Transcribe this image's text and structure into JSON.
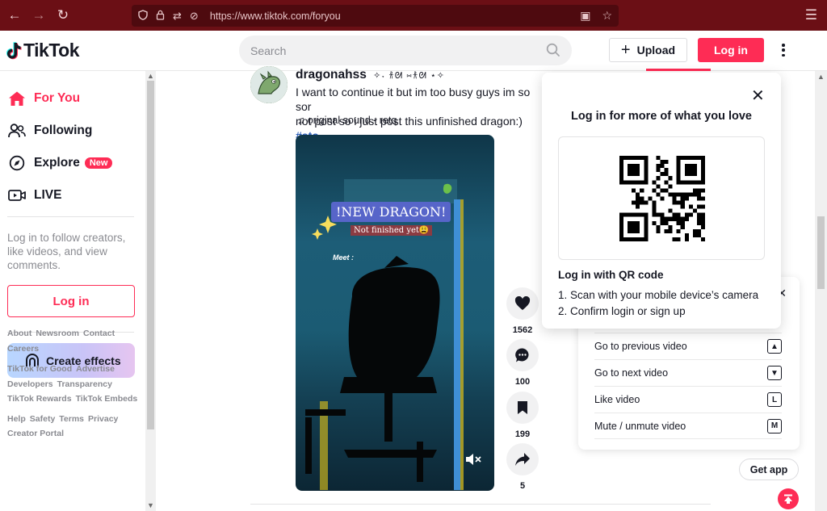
{
  "browser": {
    "url": "https://www.tiktok.com/foryou"
  },
  "header": {
    "logo_text": "TikTok",
    "search_placeholder": "Search",
    "upload_label": "Upload",
    "login_label": "Log in"
  },
  "sidebar": {
    "nav": [
      {
        "label": "For You",
        "icon": "home-icon",
        "active": true
      },
      {
        "label": "Following",
        "icon": "people-icon"
      },
      {
        "label": "Explore",
        "icon": "compass-icon",
        "badge": "New"
      },
      {
        "label": "LIVE",
        "icon": "live-icon"
      }
    ],
    "prompt_text": "Log in to follow creators, like videos, and view comments.",
    "login_label": "Log in",
    "effects_label": "Create effects",
    "footer_rows": [
      [
        "About",
        "Newsroom",
        "Contact"
      ],
      [
        "Careers"
      ],
      [
        "TikTok for Good",
        "Advertise"
      ],
      [
        "Developers",
        "Transparency"
      ],
      [
        "TikTok Rewards",
        "TikTok Embeds"
      ],
      [
        "Help",
        "Safety",
        "Terms",
        "Privacy"
      ],
      [
        "Creator Portal"
      ]
    ]
  },
  "post": {
    "author": "dragonahss",
    "author_deco": "✧˖ 𐀪ᘛ ⑅𐀪ᘛ ⋆✧",
    "caption": "I want to continue it but im too busy guys im so sor",
    "caption_line2": "not post so i just post this unfinished dragon:)",
    "hashtag": "#sto",
    "sound": "original sound - retq",
    "video_title": "!NEW DRAGON!",
    "video_subtitle": "Not finished yet😩",
    "video_meet": "Meet :",
    "likes": "1562",
    "comments": "100",
    "saves": "199",
    "shares": "5"
  },
  "login_modal": {
    "title": "Log in for more of what you love",
    "qr_heading": "Log in with QR code",
    "steps": [
      "1. Scan with your mobile device’s camera",
      "2. Confirm login or sign up"
    ]
  },
  "shortcuts": [
    {
      "label": "Go to previous video",
      "key": "▲"
    },
    {
      "label": "Go to next video",
      "key": "▼"
    },
    {
      "label": "Like video",
      "key": "L"
    },
    {
      "label": "Mute / unmute video",
      "key": "M"
    }
  ],
  "get_app_label": "Get app",
  "colors": {
    "brand": "#fe2c55",
    "chrome": "#6b0f15"
  }
}
